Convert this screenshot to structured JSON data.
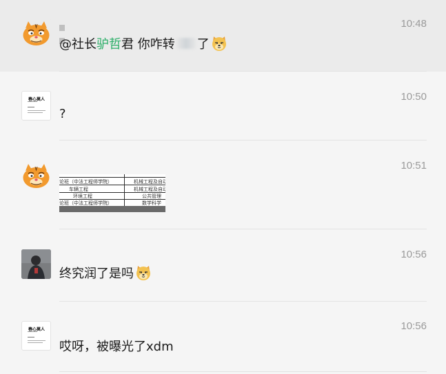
{
  "messages": [
    {
      "time": "10:48",
      "mention": "@社长",
      "mention_name": "驴哲",
      "text_after_name": "君 你咋转",
      "text_after_blur": "了",
      "emoji": "doge-emoji",
      "avatar": "garfield-avatar"
    },
    {
      "time": "10:50",
      "text": "?",
      "avatar": "document-avatar",
      "avatar_heading": "春心莫人"
    },
    {
      "time": "10:51",
      "avatar": "garfield-avatar",
      "image": {
        "rows": [
          {
            "left": "论班（中法工程师学院）",
            "right": "机械工程及自动"
          },
          {
            "left": "车辆工程",
            "right": "机械工程及自动"
          },
          {
            "left": "环境工程",
            "right": "公共管理"
          },
          {
            "left": "论班（中法工程师学院）",
            "right": "数学科学"
          }
        ]
      }
    },
    {
      "time": "10:56",
      "text": "终究润了是吗",
      "emoji": "doge-emoji",
      "avatar": "person-photo-avatar"
    },
    {
      "time": "10:56",
      "text": "哎呀，被曝光了xdm",
      "avatar": "document-avatar",
      "avatar_heading": "春心莫人"
    }
  ],
  "colors": {
    "highlight_bg": "#ebebeb",
    "bg": "#f5f5f5",
    "mention_green": "#2aae67",
    "time_gray": "#9a9a9a"
  }
}
